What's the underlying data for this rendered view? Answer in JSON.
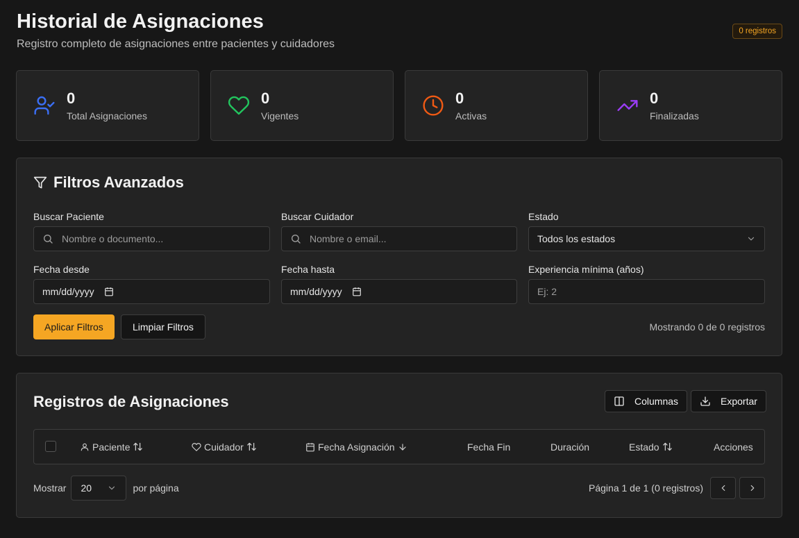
{
  "header": {
    "title": "Historial de Asignaciones",
    "subtitle": "Registro completo de asignaciones entre pacientes y cuidadores",
    "badge": "0 registros"
  },
  "stats": [
    {
      "value": "0",
      "label": "Total Asignaciones",
      "icon": "user-check-icon",
      "color": "#3b6ff5"
    },
    {
      "value": "0",
      "label": "Vigentes",
      "icon": "heart-icon",
      "color": "#22c55e"
    },
    {
      "value": "0",
      "label": "Activas",
      "icon": "clock-icon",
      "color": "#f05a14"
    },
    {
      "value": "0",
      "label": "Finalizadas",
      "icon": "trending-up-icon",
      "color": "#9b3df5"
    }
  ],
  "filters": {
    "title": "Filtros Avanzados",
    "patient": {
      "label": "Buscar Paciente",
      "placeholder": "Nombre o documento..."
    },
    "caregiver": {
      "label": "Buscar Cuidador",
      "placeholder": "Nombre o email..."
    },
    "status": {
      "label": "Estado",
      "value": "Todos los estados"
    },
    "date_from": {
      "label": "Fecha desde",
      "value": "mm/dd/yyyy"
    },
    "date_to": {
      "label": "Fecha hasta",
      "value": "mm/dd/yyyy"
    },
    "experience": {
      "label": "Experiencia mínima (años)",
      "placeholder": "Ej: 2"
    },
    "apply_label": "Aplicar Filtros",
    "clear_label": "Limpiar Filtros",
    "showing": "Mostrando 0 de 0 registros"
  },
  "records": {
    "title": "Registros de Asignaciones",
    "columns_label": "Columnas",
    "export_label": "Exportar",
    "headers": {
      "patient": "Paciente",
      "caregiver": "Cuidador",
      "date": "Fecha Asignación",
      "end": "Fecha Fin",
      "duration": "Duración",
      "status": "Estado",
      "actions": "Acciones"
    },
    "show_label": "Mostrar",
    "per_page_value": "20",
    "per_page_label": "por página",
    "page_info": "Página 1 de 1 (0 registros)"
  },
  "colors": {
    "accent": "#f5a623",
    "background": "#171717",
    "card": "#232323"
  }
}
